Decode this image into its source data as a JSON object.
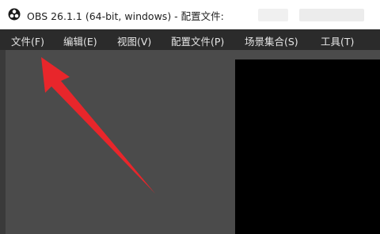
{
  "window": {
    "title": "OBS 26.1.1 (64-bit, windows) - 配置文件:",
    "icon": "obs-logo-icon"
  },
  "menubar": {
    "items": [
      {
        "label": "文件(F)"
      },
      {
        "label": "编辑(E)"
      },
      {
        "label": "视图(V)"
      },
      {
        "label": "配置文件(P)"
      },
      {
        "label": "场景集合(S)"
      },
      {
        "label": "工具(T)"
      }
    ]
  },
  "annotation": {
    "type": "arrow",
    "color": "#e8262b"
  },
  "colors": {
    "menubar_bg": "#2b2b2b",
    "workspace_bg": "#4b4b4b",
    "preview_bg": "#000000"
  }
}
